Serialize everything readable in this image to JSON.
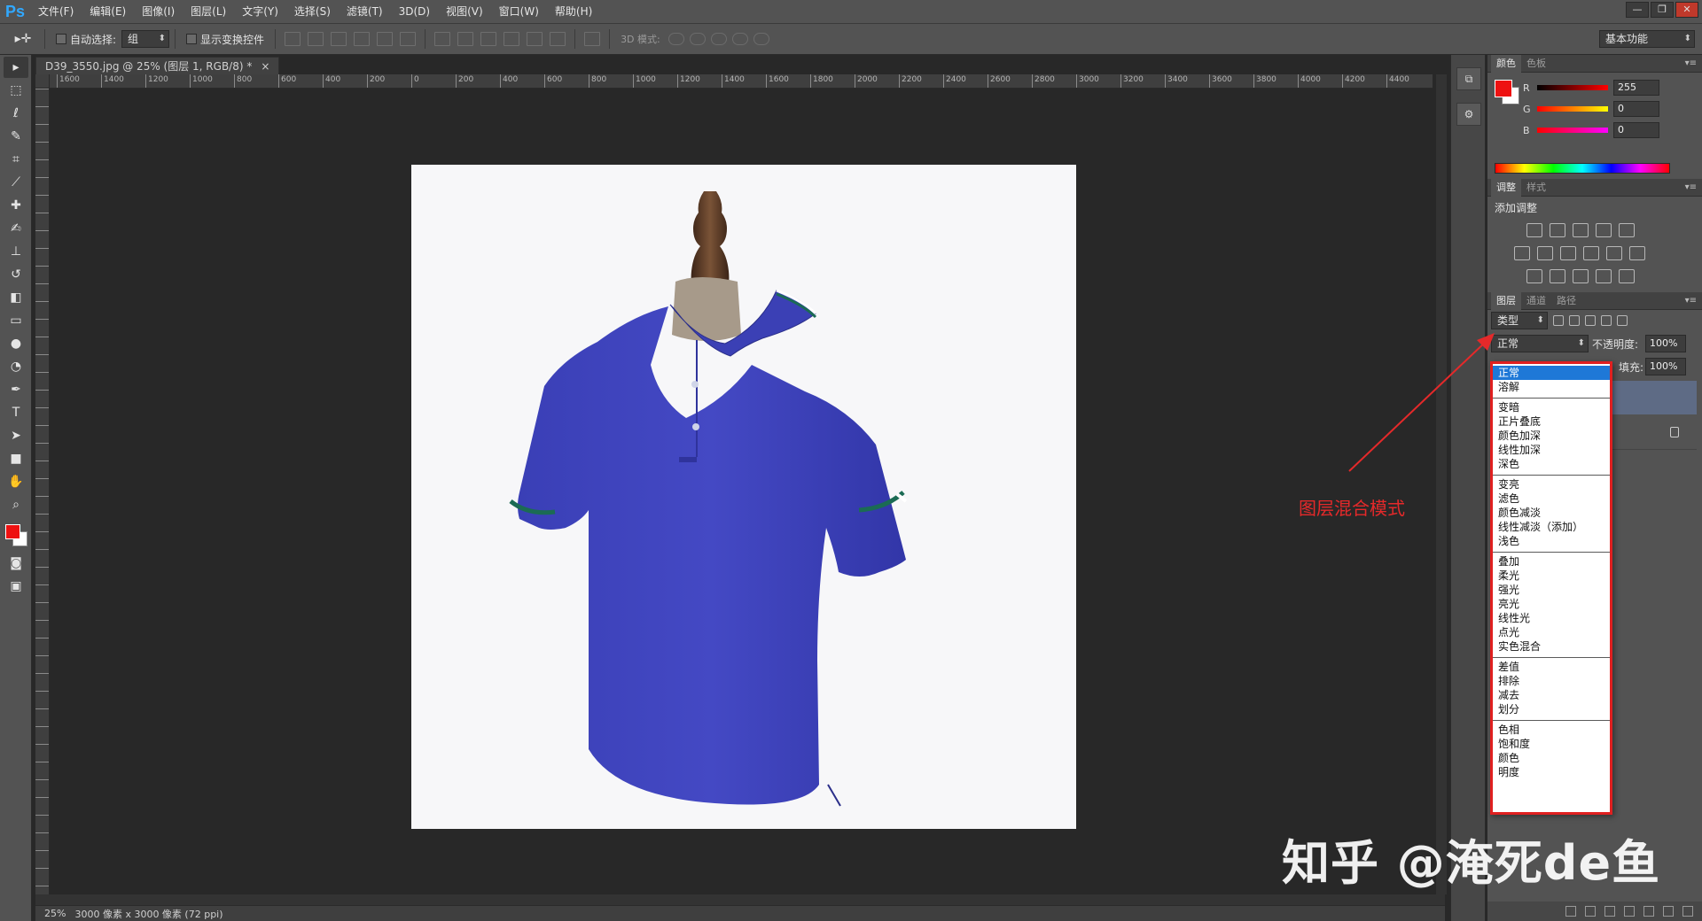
{
  "app": {
    "logo": "Ps"
  },
  "menu": [
    "文件(F)",
    "编辑(E)",
    "图像(I)",
    "图层(L)",
    "文字(Y)",
    "选择(S)",
    "滤镜(T)",
    "3D(D)",
    "视图(V)",
    "窗口(W)",
    "帮助(H)"
  ],
  "window_controls": {
    "minimize": "—",
    "restore": "❐",
    "close": "✕"
  },
  "options": {
    "auto_select_label": "自动选择:",
    "auto_select_value": "组",
    "show_transform_label": "显示变换控件",
    "mode3d_label": "3D 模式:",
    "workspace": "基本功能"
  },
  "document": {
    "tab_title": "D39_3550.jpg @ 25% (图层 1, RGB/8) *",
    "tab_close": "×",
    "zoom": "25%",
    "size_info": "3000 像素 x 3000 像素 (72 ppi)"
  },
  "ruler_top": [
    "1600",
    "1400",
    "1200",
    "1000",
    "800",
    "600",
    "400",
    "200",
    "0",
    "200",
    "400",
    "600",
    "800",
    "1000",
    "1200",
    "1400",
    "1600",
    "1800",
    "2000",
    "2200",
    "2400",
    "2600",
    "2800",
    "3000",
    "3200",
    "3400",
    "3600",
    "3800",
    "4000",
    "4200",
    "4400"
  ],
  "color_panel": {
    "tabs": [
      "颜色",
      "色板"
    ],
    "r_label": "R",
    "r_value": "255",
    "g_label": "G",
    "g_value": "0",
    "b_label": "B",
    "b_value": "0",
    "fg_color": "#ee1111",
    "bg_color": "#ffffff"
  },
  "adjust_panel": {
    "tabs": [
      "调整",
      "样式"
    ],
    "title": "添加调整"
  },
  "layers_panel": {
    "tabs": [
      "图层",
      "通道",
      "路径"
    ],
    "filter_label": "类型",
    "blend_value": "正常",
    "opacity_label": "不透明度:",
    "opacity_value": "100%",
    "fill_label": "填充:",
    "fill_value": "100%"
  },
  "blend_modes": [
    [
      "正常",
      "溶解"
    ],
    [
      "变暗",
      "正片叠底",
      "颜色加深",
      "线性加深",
      "深色"
    ],
    [
      "变亮",
      "滤色",
      "颜色减淡",
      "线性减淡（添加）",
      "浅色"
    ],
    [
      "叠加",
      "柔光",
      "强光",
      "亮光",
      "线性光",
      "点光",
      "实色混合"
    ],
    [
      "差值",
      "排除",
      "减去",
      "划分"
    ],
    [
      "色相",
      "饱和度",
      "颜色",
      "明度"
    ]
  ],
  "annotation": {
    "label": "图层混合模式",
    "color": "#e5292a"
  },
  "watermark": "知乎 @淹死de鱼"
}
